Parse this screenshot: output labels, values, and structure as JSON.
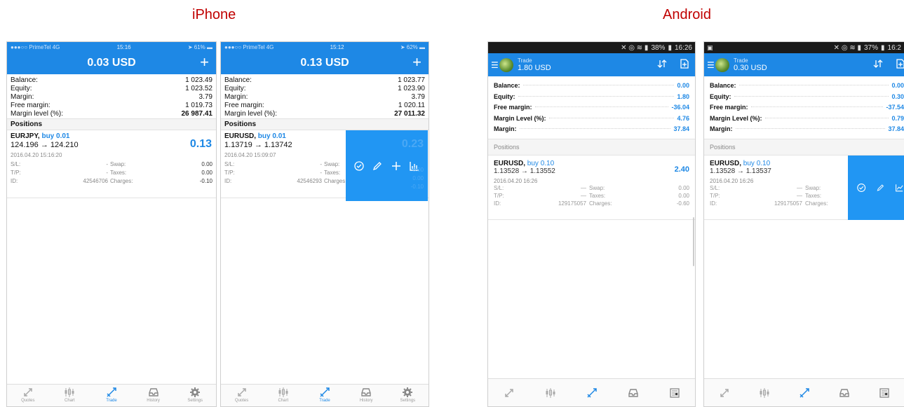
{
  "titles": {
    "iphone": "iPhone",
    "android": "Android"
  },
  "ios_tabs": [
    "Quotes",
    "Chart",
    "Trade",
    "History",
    "Settings"
  ],
  "phones": {
    "ios1": {
      "status": {
        "carrier": "●●●○○ PrimeTel  4G",
        "time": "15:16",
        "battery": "61%"
      },
      "header_amount": "0.03 USD",
      "header_plus": "+",
      "account": [
        {
          "k": "Balance:",
          "v": "1 023.49"
        },
        {
          "k": "Equity:",
          "v": "1 023.52"
        },
        {
          "k": "Margin:",
          "v": "3.79"
        },
        {
          "k": "Free margin:",
          "v": "1 019.73"
        },
        {
          "k": "Margin level (%):",
          "v": "26 987.41"
        }
      ],
      "section": "Positions",
      "position": {
        "symbol": "EURJPY,",
        "side": "buy 0.01",
        "prices": "124.196 → 124.210",
        "profit": "0.13",
        "date": "2016.04.20 15:16:20",
        "sl_label": "S/L:",
        "sl": "-",
        "swap_label": "Swap:",
        "swap": "0.00",
        "tp_label": "T/P:",
        "tp": "-",
        "taxes_label": "Taxes:",
        "taxes": "0.00",
        "id_label": "ID:",
        "id": "42546706",
        "charges_label": "Charges:",
        "charges": "-0.10"
      }
    },
    "ios2": {
      "status": {
        "carrier": "●●●○○ PrimeTel  4G",
        "time": "15:12",
        "battery": "62%"
      },
      "header_amount": "0.13 USD",
      "header_plus": "+",
      "account": [
        {
          "k": "Balance:",
          "v": "1 023.77"
        },
        {
          "k": "Equity:",
          "v": "1 023.90"
        },
        {
          "k": "Margin:",
          "v": "3.79"
        },
        {
          "k": "Free margin:",
          "v": "1 020.11"
        },
        {
          "k": "Margin level (%):",
          "v": "27 011.32"
        }
      ],
      "section": "Positions",
      "position": {
        "symbol": "EURUSD,",
        "side": "buy 0.01",
        "prices": "1.13719 → 1.13742",
        "profit": "0.23",
        "date": "2016.04.20 15:09:07",
        "sl_label": "S/L:",
        "sl": "-",
        "swap_label": "Swap:",
        "swap": "0.00",
        "tp_label": "T/P:",
        "tp": "-",
        "taxes_label": "Taxes:",
        "taxes": "0.00",
        "id_label": "ID:",
        "id": "42546293",
        "charges_label": "Charges:",
        "charges": "-0.10"
      }
    },
    "and1": {
      "status": {
        "battery": "38%",
        "time": "16:26"
      },
      "header_small": "Trade",
      "header_amount": "1.80 USD",
      "account": [
        {
          "k": "Balance:",
          "v": "0.00"
        },
        {
          "k": "Equity:",
          "v": "1.80"
        },
        {
          "k": "Free margin:",
          "v": "-36.04"
        },
        {
          "k": "Margin Level (%):",
          "v": "4.76"
        },
        {
          "k": "Margin:",
          "v": "37.84"
        }
      ],
      "section": "Positions",
      "position": {
        "symbol": "EURUSD,",
        "side": "buy 0.10",
        "prices": "1.13528 → 1.13552",
        "profit": "2.40",
        "date": "2016.04.20 16:26",
        "sl_label": "S/L:",
        "sl": "—",
        "swap_label": "Swap:",
        "swap": "0.00",
        "tp_label": "T/P:",
        "tp": "—",
        "taxes_label": "Taxes:",
        "taxes": "0.00",
        "id_label": "ID:",
        "id": "129175057",
        "charges_label": "Charges:",
        "charges": "-0.60"
      }
    },
    "and2": {
      "status": {
        "battery": "37%",
        "time": "16:2"
      },
      "header_small": "Trade",
      "header_amount": "0.30 USD",
      "account": [
        {
          "k": "Balance:",
          "v": "0.00"
        },
        {
          "k": "Equity:",
          "v": "0.30"
        },
        {
          "k": "Free margin:",
          "v": "-37.54"
        },
        {
          "k": "Margin Level (%):",
          "v": "0.79"
        },
        {
          "k": "Margin:",
          "v": "37.84"
        }
      ],
      "section": "Positions",
      "position": {
        "symbol": "EURUSD,",
        "side": "buy 0.10",
        "prices": "1.13528 → 1.13537",
        "date": "2016.04.20 16:26",
        "sl_label": "S/L:",
        "sl": "—",
        "swap_label": "Swap:",
        "tp_label": "T/P:",
        "tp": "—",
        "taxes_label": "Taxes:",
        "id_label": "ID:",
        "id": "129175057",
        "charges_label": "Charges:"
      }
    }
  }
}
